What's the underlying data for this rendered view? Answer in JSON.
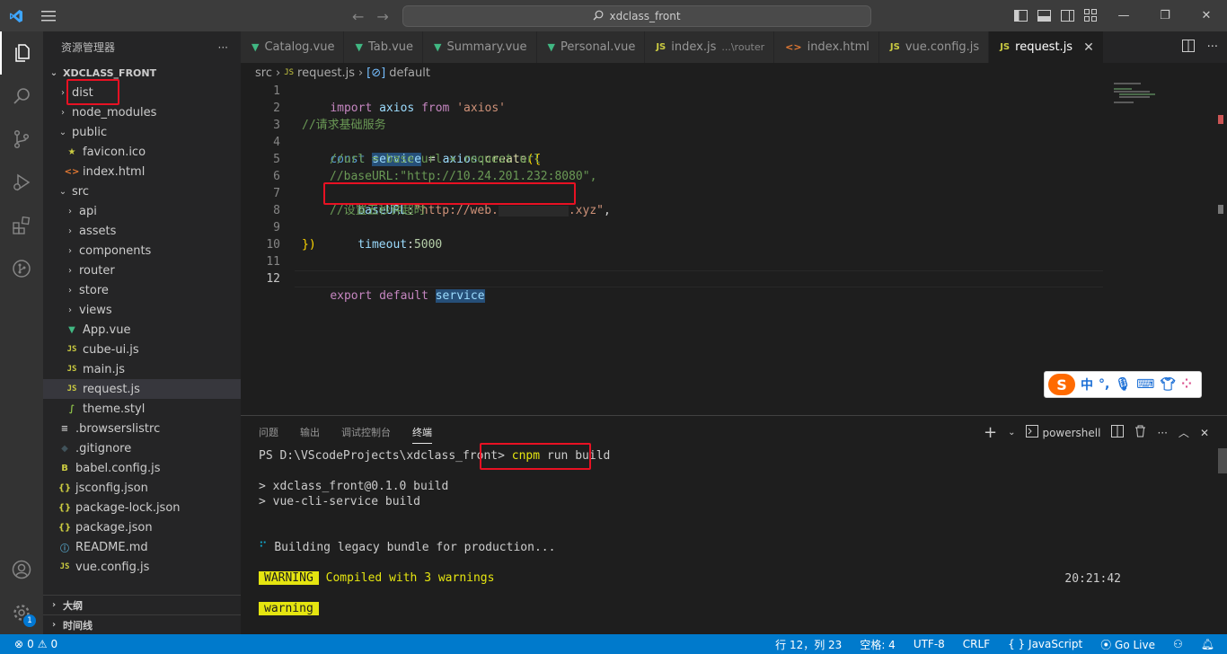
{
  "titlebar": {
    "search_text": "xdclass_front"
  },
  "sidebar": {
    "header": "资源管理器",
    "more": "···",
    "root": "XDCLASS_FRONT",
    "items": [
      {
        "label": "dist",
        "icon": "chevron-right"
      },
      {
        "label": "node_modules",
        "icon": "chevron-right"
      },
      {
        "label": "public",
        "icon": "chevron-down"
      },
      {
        "label": "favicon.ico",
        "icon": "star"
      },
      {
        "label": "index.html",
        "icon": "html"
      },
      {
        "label": "src",
        "icon": "chevron-down"
      },
      {
        "label": "api",
        "icon": "chevron-right"
      },
      {
        "label": "assets",
        "icon": "chevron-right"
      },
      {
        "label": "components",
        "icon": "chevron-right"
      },
      {
        "label": "router",
        "icon": "chevron-right"
      },
      {
        "label": "store",
        "icon": "chevron-right"
      },
      {
        "label": "views",
        "icon": "chevron-right"
      },
      {
        "label": "App.vue",
        "icon": "vue"
      },
      {
        "label": "cube-ui.js",
        "icon": "js"
      },
      {
        "label": "main.js",
        "icon": "js"
      },
      {
        "label": "request.js",
        "icon": "js"
      },
      {
        "label": "theme.styl",
        "icon": "styl"
      },
      {
        "label": ".browserslistrc",
        "icon": "list"
      },
      {
        "label": ".gitignore",
        "icon": "git"
      },
      {
        "label": "babel.config.js",
        "icon": "babel"
      },
      {
        "label": "jsconfig.json",
        "icon": "json"
      },
      {
        "label": "package-lock.json",
        "icon": "json"
      },
      {
        "label": "package.json",
        "icon": "json"
      },
      {
        "label": "README.md",
        "icon": "info"
      },
      {
        "label": "vue.config.js",
        "icon": "js"
      }
    ],
    "outline": "大纲",
    "timeline": "时间线"
  },
  "tabs": [
    {
      "label": "Catalog.vue",
      "icon": "vue"
    },
    {
      "label": "Tab.vue",
      "icon": "vue"
    },
    {
      "label": "Summary.vue",
      "icon": "vue"
    },
    {
      "label": "Personal.vue",
      "icon": "vue"
    },
    {
      "label": "index.js",
      "icon": "js",
      "suffix": "...\\router"
    },
    {
      "label": "index.html",
      "icon": "html"
    },
    {
      "label": "vue.config.js",
      "icon": "js"
    },
    {
      "label": "request.js",
      "icon": "js",
      "active": true
    }
  ],
  "tab_icon_text": {
    "js": "JS",
    "vue": "▼",
    "html": "<>"
  },
  "breadcrumb": {
    "folder": "src",
    "file": "request.js",
    "symbol": "default"
  },
  "editor": {
    "line_numbers": [
      "1",
      "2",
      "3",
      "4",
      "5",
      "6",
      "7",
      "8",
      "9",
      "10",
      "11",
      "12"
    ],
    "l1": {
      "kw": "import",
      "id": "axios",
      "from": "from",
      "str": "'axios'"
    },
    "l3": "//请求基础服务",
    "l4": {
      "kw": "const",
      "id": "service",
      "eq": " = ",
      "obj": "axios",
      "dot": ".",
      "fn": "create",
      "open": "({"
    },
    "l5": "//url = base url + request url",
    "l6": "//baseURL:\"http://10.24.201.232:8080\",",
    "l7": {
      "key": "baseURL",
      "colon": ":",
      "str_a": "\"http://web.",
      "str_b": ".xyz\"",
      "comma": ","
    },
    "l8": "//设置五秒钟超时",
    "l9": {
      "key": "timeout",
      "colon": ":",
      "num": "5000"
    },
    "l10": "})",
    "l12": {
      "kw1": "export",
      "kw2": "default",
      "id": "service"
    }
  },
  "panel": {
    "tabs": [
      "问题",
      "输出",
      "调试控制台",
      "终端"
    ],
    "active_tab": "终端",
    "shell": "powershell",
    "prompt": "PS D:\\VScodeProjects\\xdclass_front>",
    "command_a": "cnpm",
    "command_b": " run build",
    "out1": "> xdclass_front@0.1.0 build",
    "out2": "> vue-cli-service build",
    "spinner": "⠋",
    "out3": " Building legacy bundle for production...",
    "warn_badge": "WARNING",
    "warn_text": " Compiled with 3 warnings",
    "time": "20:21:42",
    "warn2": "warning"
  },
  "ime": {
    "logo": "S",
    "lang": "中",
    "punct": "°,"
  },
  "statusbar": {
    "errors": "0",
    "warnings": "0",
    "position": "行 12，列 23",
    "spaces": "空格: 4",
    "encoding": "UTF-8",
    "eol": "CRLF",
    "language": "JavaScript",
    "lang_braces": "{ }",
    "golive": "Go Live"
  },
  "activity_badge": "1",
  "colors": {
    "accent": "#007acc",
    "highlight_box": "#e81123",
    "warning": "#e5e510"
  }
}
